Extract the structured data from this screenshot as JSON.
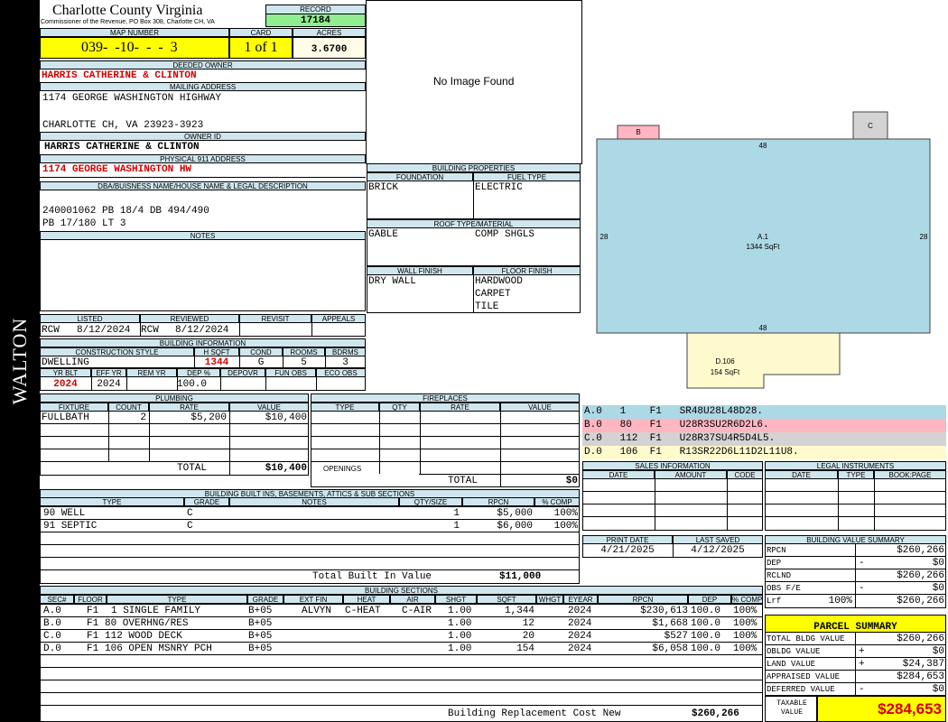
{
  "side_label": "WALTON",
  "header": {
    "county": "Charlotte County Virginia",
    "subtitle": "Commissioner of the Revenue, PO Box 308, Charlotte CH, VA",
    "record_label": "RECORD",
    "record": "17184",
    "map_label": "MAP NUMBER",
    "map_number": "039-  -10-  -  -  3",
    "card_label": "CARD",
    "card": "1 of 1",
    "acres_label": "ACRES",
    "acres": "3.6700"
  },
  "owner": {
    "deeded_label": "DEEDED OWNER",
    "deeded": "HARRIS CATHERINE & CLINTON",
    "mailing_label": "MAILING ADDRESS",
    "mail1": "1174 GEORGE WASHINGTON HIGHWAY",
    "mail2": "CHARLOTTE CH, VA 23923-3923",
    "owner_id_label": "OWNER ID",
    "owner_id": "HARRIS CATHERINE & CLINTON",
    "phys_label": "PHYSICAL 911 ADDRESS",
    "phys": "1174 GEORGE WASHINGTON HW",
    "dba_label": "DBA/BUISNESS NAME/HOUSE NAME & LEGAL DESCRIPTION",
    "legal1": "240001062 PB 18/4 DB 494/490",
    "legal2": "PB 17/180 LT 3",
    "notes_label": "NOTES"
  },
  "image": {
    "text": "No Image Found"
  },
  "building_props": {
    "title": "BUILDING PROPERTIES",
    "foundation_label": "FOUNDATION",
    "foundation": "BRICK",
    "fuel_label": "FUEL TYPE",
    "fuel": "ELECTRIC",
    "roof_label": "ROOF TYPE/MATERIAL",
    "roof1": "GABLE",
    "roof2": "COMP SHGLS",
    "wall_label": "WALL FINISH",
    "wall": "DRY WALL",
    "floor_label": "FLOOR FINISH",
    "floor1": "HARDWOOD",
    "floor2": "CARPET",
    "floor3": "TILE"
  },
  "review": {
    "listed_label": "LISTED",
    "listed_by": "RCW",
    "listed_date": "8/12/2024",
    "reviewed_label": "REVIEWED",
    "reviewed_by": "RCW",
    "reviewed_date": "8/12/2024",
    "revisit_label": "REVISIT",
    "appeals_label": "APPEALS"
  },
  "bldg_info": {
    "title": "BUILDING INFORMATION",
    "style_label": "CONSTRUCTION STYLE",
    "hsqft_label": "H SQFT",
    "cond_label": "COND",
    "rooms_label": "ROOMS",
    "bdrms_label": "BDRMS",
    "style": "DWELLING",
    "hsqft": "1344",
    "cond": "G",
    "rooms": "5",
    "bdrms": "3",
    "yrblt_label": "YR BLT",
    "effyr_label": "EFF YR",
    "remyr_label": "REM YR",
    "dep_label": "DEP %",
    "depovr_label": "DEPOVR",
    "funobs_label": "FUN OBS",
    "ecoobs_label": "ECO OBS",
    "yrblt": "2024",
    "effyr": "2024",
    "dep": "100.0"
  },
  "plumbing": {
    "title": "PLUMBING",
    "h_fixture": "FIXTURE",
    "h_count": "COUNT",
    "h_rate": "RATE",
    "h_value": "VALUE",
    "rows": [
      {
        "fixture": "FULLBATH",
        "count": "2",
        "rate": "$5,200",
        "value": "$10,400"
      }
    ],
    "total_label": "TOTAL",
    "total": "$10,400"
  },
  "fireplaces": {
    "title": "FIREPLACES",
    "h_type": "TYPE",
    "h_qty": "QTY",
    "h_rate": "RATE",
    "h_value": "VALUE",
    "openings_label": "OPENINGS",
    "total_label": "TOTAL",
    "total": "$0"
  },
  "sketch": {
    "areas": [
      {
        "label": "B"
      },
      {
        "label": "C"
      },
      {
        "label": "A.1",
        "sqft": "1344 SqFt"
      },
      {
        "label": "D.106",
        "sqft": "154 SqFt"
      }
    ],
    "dims": {
      "top": "48",
      "left": "28",
      "right": "28",
      "bottom": "48"
    },
    "legend": [
      {
        "text": "A.0   1    F1   SR48U28L48D28.",
        "color": "#add8e6"
      },
      {
        "text": "B.0   80   F1   U28R3SU2R6D2L6.",
        "color": "#ffb6c1"
      },
      {
        "text": "C.0   112  F1   U28R37SU4R5D4L5.",
        "color": "#d3d3d3"
      },
      {
        "text": "D.0   106  F1   R13SR22D6L11D2L11U8.",
        "color": "#fffacd"
      }
    ]
  },
  "sales": {
    "title": "SALES INFORMATION",
    "h_date": "DATE",
    "h_amount": "AMOUNT",
    "h_code": "CODE"
  },
  "legal_inst": {
    "title": "LEGAL INSTRUMENTS",
    "h_date": "DATE",
    "h_type": "TYPE",
    "h_book": "BOOK:PAGE"
  },
  "builtins": {
    "title": "BUILDING BUILT INS, BASEMENTS, ATTICS & SUB SECTIONS",
    "h_type": "TYPE",
    "h_grade": "GRADE",
    "h_notes": "NOTES",
    "h_qty": "QTY/SIZE",
    "h_rpcn": "RPCN",
    "h_comp": "% COMP",
    "rows": [
      {
        "type": "90 WELL",
        "grade": "C",
        "qty": "1",
        "rpcn": "$5,000",
        "comp": "100%"
      },
      {
        "type": "91 SEPTIC",
        "grade": "C",
        "qty": "1",
        "rpcn": "$6,000",
        "comp": "100%"
      }
    ],
    "total_label": "Total Built In Value",
    "total": "$11,000"
  },
  "dates": {
    "print_label": "PRINT DATE",
    "print": "4/21/2025",
    "saved_label": "LAST SAVED",
    "saved": "4/12/2025"
  },
  "value_summary": {
    "title": "BUILDING VALUE SUMMARY",
    "rows": [
      {
        "label": "RPCN",
        "sign": "",
        "value": "$260,266"
      },
      {
        "label": "DEP",
        "sign": "-",
        "value": "$0"
      },
      {
        "label": "RCLND",
        "sign": "",
        "value": "$260,266"
      },
      {
        "label": "OBS F/E",
        "sign": "-",
        "value": "$0"
      },
      {
        "label": "Lrf",
        "sign": "100%",
        "value": "$260,266"
      }
    ]
  },
  "sections": {
    "title": "BUILDING SECTIONS",
    "h": [
      "SEC#",
      "FLOOR",
      "TYPE",
      "GRADE",
      "EXT FIN",
      "HEAT",
      "AIR",
      "SHGT",
      "SQFT",
      "WHGT",
      "EYEAR",
      "RPCN",
      "DEP",
      "% COMP"
    ],
    "rows": [
      {
        "sec": "A.0",
        "floor": "F1",
        "type": "1 SINGLE FAMILY",
        "grade": "B+05",
        "ext": "ALVYN",
        "heat": "C-HEAT",
        "air": "C-AIR",
        "shgt": "1.00",
        "sqft": "1,344",
        "eyear": "2024",
        "rpcn": "$230,613",
        "dep": "100.0",
        "comp": "100%"
      },
      {
        "sec": "B.0",
        "floor": "F1",
        "type": "80 OVERHNG/RES",
        "grade": "B+05",
        "ext": "",
        "heat": "",
        "air": "",
        "shgt": "1.00",
        "sqft": "12",
        "eyear": "2024",
        "rpcn": "$1,668",
        "dep": "100.0",
        "comp": "100%"
      },
      {
        "sec": "C.0",
        "floor": "F1",
        "type": "112 WOOD DECK",
        "grade": "B+05",
        "ext": "",
        "heat": "",
        "air": "",
        "shgt": "1.00",
        "sqft": "20",
        "eyear": "2024",
        "rpcn": "$527",
        "dep": "100.0",
        "comp": "100%"
      },
      {
        "sec": "D.0",
        "floor": "F1",
        "type": "106 OPEN MSNRY PCH",
        "grade": "B+05",
        "ext": "",
        "heat": "",
        "air": "",
        "shgt": "1.00",
        "sqft": "154",
        "eyear": "2024",
        "rpcn": "$6,058",
        "dep": "100.0",
        "comp": "100%"
      }
    ],
    "total_label": "Building Replacement Cost New",
    "total": "$260,266"
  },
  "parcel": {
    "title": "PARCEL SUMMARY",
    "rows": [
      {
        "label": "TOTAL BLDG VALUE",
        "sign": "",
        "value": "$260,266"
      },
      {
        "label": "OBLDG VALUE",
        "sign": "+",
        "value": "$0"
      },
      {
        "label": "LAND VALUE",
        "sign": "+",
        "value": "$24,387"
      },
      {
        "label": "APPRAISED VALUE",
        "sign": "",
        "value": "$284,653"
      },
      {
        "label": "DEFERRED VALUE",
        "sign": "-",
        "value": "$0"
      }
    ],
    "taxable_label": "TAXABLE VALUE",
    "taxable": "$284,653"
  }
}
